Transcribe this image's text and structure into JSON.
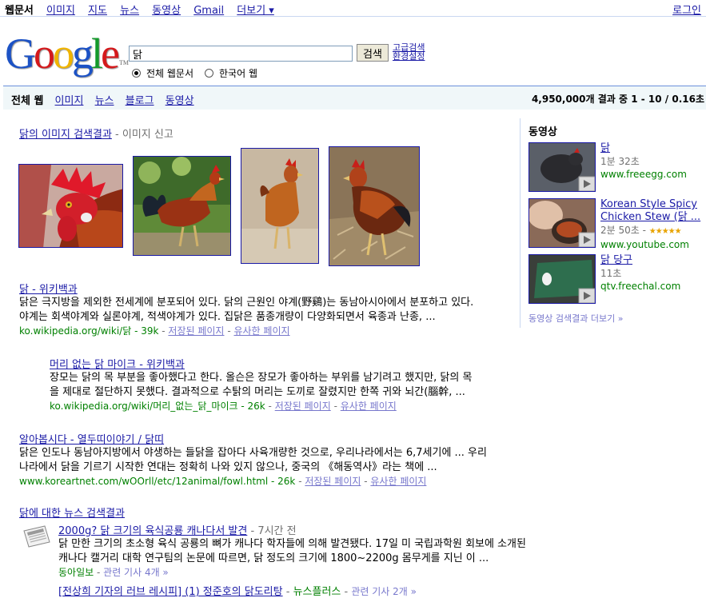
{
  "topnav": {
    "current": "웹문서",
    "items": [
      "이미지",
      "지도",
      "뉴스",
      "동영상",
      "Gmail"
    ],
    "more": "더보기 ▾",
    "login": "로그인"
  },
  "header": {
    "logo_text": "Google",
    "query": "닭",
    "search_button": "검색",
    "advanced_search": "고급검색",
    "preferences": "환경설정",
    "radio_all": "전체 웹문서",
    "radio_korean": "한국어 웹"
  },
  "results_bar": {
    "current_tab": "전체 웹",
    "tabs": [
      "이미지",
      "뉴스",
      "블로그",
      "동영상"
    ],
    "stats_prefix": "4,950,000개 결과 중 ",
    "stats_range": "1 - 10",
    "stats_sep": " / ",
    "stats_time": "0.16초"
  },
  "image_results": {
    "title": "닭의 이미지 검색결과",
    "report": "이미지 신고"
  },
  "results": [
    {
      "title": "닭 - 위키백과",
      "snippet1": "닭은 극지방을 제외한 전세계에 분포되어 있다. 닭의 근원인 야계(野鷄)는 동남아시아에서 분포하고 있다.",
      "snippet2": "야계는 회색야계와 실론야계, 적색야계가 있다. 집닭은 품종개량이 다양화되면서 육종과 난종, ...",
      "url": "ko.wikipedia.org/wiki/닭 - 39k",
      "cached": "저장된 페이지",
      "similar": "유사한 페이지"
    },
    {
      "title": "머리 없는 닭 마이크 - 위키백과",
      "snippet1": "장모는 닭의 목 부분을 좋아했다고 한다. 올슨은 장모가 좋아하는 부위를 남기려고 했지만, 닭의 목",
      "snippet2": "을 제대로 절단하지 못했다. 결과적으로 수탉의 머리는 도끼로 잘렸지만 한쪽 귀와 뇌간(腦幹, ...",
      "url": "ko.wikipedia.org/wiki/머리_없는_닭_마이크 - 26k",
      "cached": "저장된 페이지",
      "similar": "유사한 페이지"
    },
    {
      "title": "알아봅시다 - 열두띠이야기 / 닭띠",
      "snippet1": "닭은 인도나 동남아지방에서 야생하는 들닭을 잡아다 사육개량한 것으로, 우리나라에서는 6,7세기에 ... 우리",
      "snippet2": "나라에서 닭을 기르기 시작한 연대는 정확히 나와 있지 않으나, 중국의 《해동역사》라는 책에 ...",
      "url": "www.koreartnet.com/wOOrll/etc/12animal/fowl.html - 26k",
      "cached": "저장된 페이지",
      "similar": "유사한 페이지"
    }
  ],
  "news": {
    "title": "닭에 대한 뉴스 검색결과",
    "item_title": "2000g? 닭 크기의 육식공룡 캐나다서 발견",
    "item_time": "7시간 전",
    "snippet1": "닭 만한 크기의 초소형 육식 공룡의 뼈가 캐나다 학자들에 의해 발견됐다. 17일 미 국립과학원 회보에 소개된",
    "snippet2": "캐나다 캘거리 대학 연구팀의 논문에 따르면, 닭 정도의 크기에 1800~2200g 몸무게를 지닌 이 ...",
    "source": "동아일보",
    "related": "관련 기사 4개 »",
    "item2_title": "[전상희 기자의 러브 레시피] (1) 정준호의 닭도리탕",
    "item2_source": "뉴스플러스",
    "item2_related": "관련 기사 2개 »"
  },
  "sidebar": {
    "heading": "동영상",
    "videos": [
      {
        "title": "닭",
        "duration": "1분 32초",
        "site": "www.freeegg.com"
      },
      {
        "title": "Korean Style Spicy Chicken Stew (닭 ...",
        "duration": "2분 50초",
        "site": "www.youtube.com"
      },
      {
        "title": "닭 당구",
        "duration": "11초",
        "site": "qtv.freechal.com"
      }
    ],
    "more": "동영상 검색결과 더보기 »"
  }
}
